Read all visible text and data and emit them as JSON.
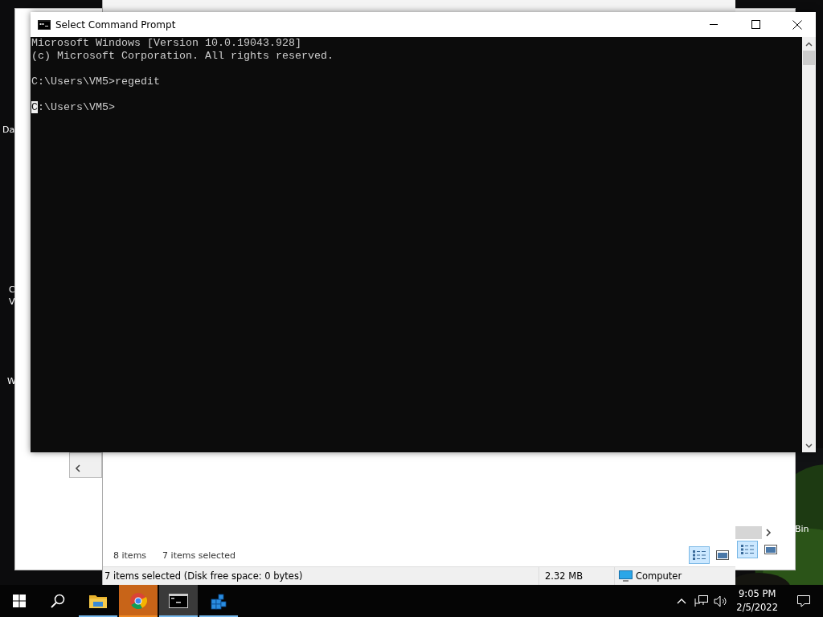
{
  "desktop": {
    "icon_labels": [
      {
        "text": "Da"
      },
      {
        "text": "C"
      },
      {
        "text": "V"
      },
      {
        "text": "W"
      },
      {
        "text": "Bin"
      }
    ]
  },
  "back_window": {
    "views": [
      {
        "kind": "details",
        "selected": true
      },
      {
        "kind": "preview",
        "selected": false
      }
    ]
  },
  "explorer_window": {
    "item_count": "8 items",
    "selected_count": "7 items selected",
    "status_text": "7 items selected (Disk free space: 0 bytes)",
    "size": "2.32 MB",
    "location": "Computer",
    "views": [
      {
        "kind": "details",
        "selected": true
      },
      {
        "kind": "preview",
        "selected": false
      }
    ]
  },
  "console_window": {
    "title": "Select Command Prompt",
    "cursor_shown": true,
    "blocks": [
      [
        "Microsoft Windows [Version 10.0.19043.928]",
        "(c) Microsoft Corporation. All rights reserved."
      ],
      [
        "C:\\Users\\VM5>regedit"
      ],
      [
        "C:\\Users\\VM5>"
      ]
    ]
  },
  "taskbar": {
    "apps": [
      {
        "kind": "folder",
        "active": false,
        "attention": false
      },
      {
        "kind": "browser",
        "active": false,
        "attention": true
      },
      {
        "kind": "console",
        "active": true,
        "attention": false
      },
      {
        "kind": "cubes",
        "active": false,
        "attention": false
      }
    ],
    "time": "9:05 PM",
    "date": "2/5/2022"
  }
}
